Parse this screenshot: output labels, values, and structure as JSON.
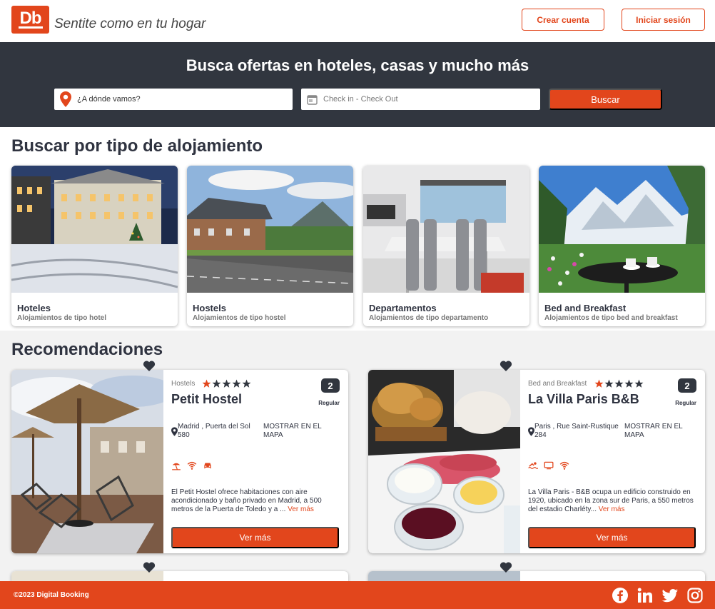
{
  "header": {
    "logo": "Db",
    "tagline": "Sentite como en tu hogar",
    "signup_label": "Crear cuenta",
    "login_label": "Iniciar sesión"
  },
  "search": {
    "title": "Busca ofertas en hoteles, casas y mucho más",
    "destination_placeholder": "¿A dónde vamos?",
    "dates_placeholder": "Check in - Check Out",
    "button_label": "Buscar"
  },
  "categories": {
    "title": "Buscar por tipo de alojamiento",
    "items": [
      {
        "name": "Hoteles",
        "desc": "Alojamientos de tipo hotel"
      },
      {
        "name": "Hostels",
        "desc": "Alojamientos de tipo hostel"
      },
      {
        "name": "Departamentos",
        "desc": "Alojamientos de tipo departamento"
      },
      {
        "name": "Bed and Breakfast",
        "desc": "Alojamientos de tipo bed and breakfast"
      }
    ]
  },
  "recommendations": {
    "title": "Recomendaciones",
    "items": [
      {
        "category": "Hostels",
        "stars": 5,
        "name": "Petit Hostel",
        "score": "2",
        "score_label": "Regular",
        "location": "Madrid , Puerta del Sol 580",
        "map_link": "MOSTRAR EN EL MAPA",
        "amenities": [
          "beach-icon",
          "wifi-icon",
          "car-icon"
        ],
        "description": "El Petit Hostel ofrece habitaciones con aire acondicionado y baño privado en Madrid, a 500 metros de la Puerta de Toledo y a ...",
        "more_link": "Ver más",
        "button_label": "Ver más"
      },
      {
        "category": "Bed and Breakfast",
        "stars": 5,
        "name": "La Villa Paris B&B",
        "score": "2",
        "score_label": "Regular",
        "location": "Paris , Rue Saint-Rustique 284",
        "map_link": "MOSTRAR EN EL MAPA",
        "amenities": [
          "pool-icon",
          "tv-icon",
          "wifi-icon"
        ],
        "description": "La Villa Paris - B&B ocupa un edificio construido en 1920, ubicado en la zona sur de Paris, a 550 metros del estadio Charléty...",
        "more_link": "Ver más",
        "button_label": "Ver más"
      }
    ]
  },
  "footer": {
    "copyright": "©2023 Digital Booking",
    "social": [
      "facebook-icon",
      "linkedin-icon",
      "twitter-icon",
      "instagram-icon"
    ]
  },
  "colors": {
    "accent": "#e2461c",
    "dark": "#31363f",
    "text": "#2f3340"
  }
}
